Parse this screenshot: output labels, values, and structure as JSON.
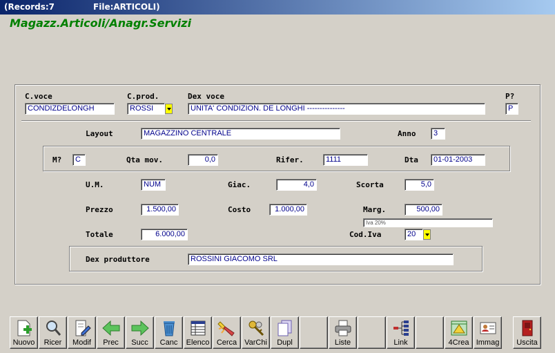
{
  "window": {
    "records": "(Records:7",
    "file": "File:ARTICOLI)"
  },
  "app_title": "Magazz.Articoli/Anagr.Servizi",
  "header": {
    "cvoce_label": "C.voce",
    "cvoce": "CONDIZDELONGH",
    "cprod_label": "C.prod.",
    "cprod": "ROSSI",
    "dex_label": "Dex voce",
    "dex": "UNITA' CONDIZION. DE LONGHI ---------------",
    "p_label": "P?",
    "p": "P"
  },
  "layout": {
    "label": "Layout",
    "value": "MAGAZZINO CENTRALE",
    "anno_label": "Anno",
    "anno": "3"
  },
  "movement": {
    "m_label": "M?",
    "m": "C",
    "qta_label": "Qta mov.",
    "qta": "0,0",
    "rifer_label": "Rifer.",
    "rifer": "1111",
    "dta_label": "Dta",
    "dta": "01-01-2003"
  },
  "details": {
    "um_label": "U.M.",
    "um": "NUM",
    "giac_label": "Giac.",
    "giac": "4,0",
    "scorta_label": "Scorta",
    "scorta": "5,0",
    "prezzo_label": "Prezzo",
    "prezzo": "1.500,00",
    "costo_label": "Costo",
    "costo": "1.000,00",
    "marg_label": "Marg.",
    "marg": "500,00",
    "iva_desc": "Iva 20%",
    "totale_label": "Totale",
    "totale": "6.000,00",
    "codiva_label": "Cod.Iva",
    "codiva": "20"
  },
  "producer": {
    "label": "Dex produttore",
    "value": "ROSSINI GIACOMO SRL"
  },
  "toolbar": {
    "nuovo": "Nuovo",
    "ricer": "Ricer",
    "modif": "Modif",
    "prec": "Prec",
    "succ": "Succ",
    "canc": "Canc",
    "elenco": "Elenco",
    "cerca": "Cerca",
    "varchi": "VarChi",
    "dupl": "Dupl",
    "liste": "Liste",
    "link": "Link",
    "crea4": "4Crea",
    "immag": "Immag",
    "uscita": "Uscita"
  }
}
